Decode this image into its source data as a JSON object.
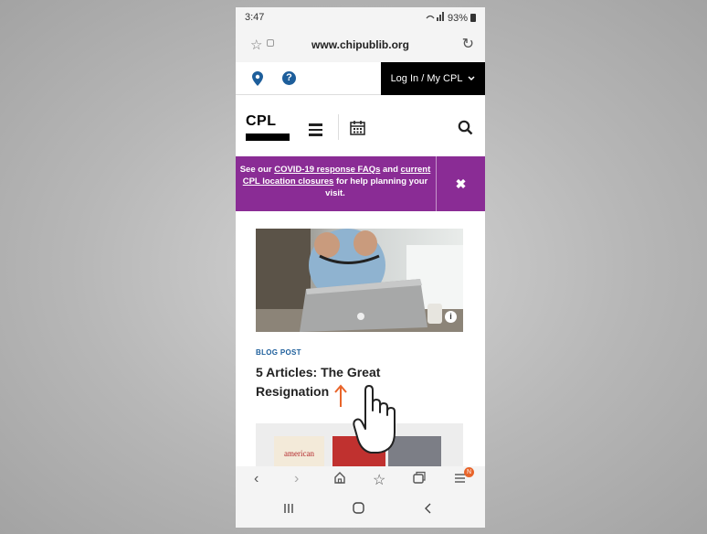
{
  "status": {
    "time": "3:47",
    "battery": "93%"
  },
  "browser": {
    "url": "www.chipublib.org"
  },
  "site": {
    "login_label": "Log In / My CPL",
    "logo_text": "CPL",
    "alert": {
      "p1": "See our ",
      "link1": "COVID-19 response FAQs",
      "p2": " and ",
      "link2": "current CPL location closures",
      "p3": " for help planning your visit."
    }
  },
  "blog": {
    "tag": "BLOG POST",
    "title": "5 Articles: The Great Resignation",
    "book_cover_text": "american"
  },
  "nav": {
    "tabs_badge": "N"
  },
  "colors": {
    "alert_bg": "#8a2c95",
    "link_blue": "#1d5e9b",
    "annotation": "#e8642a"
  }
}
